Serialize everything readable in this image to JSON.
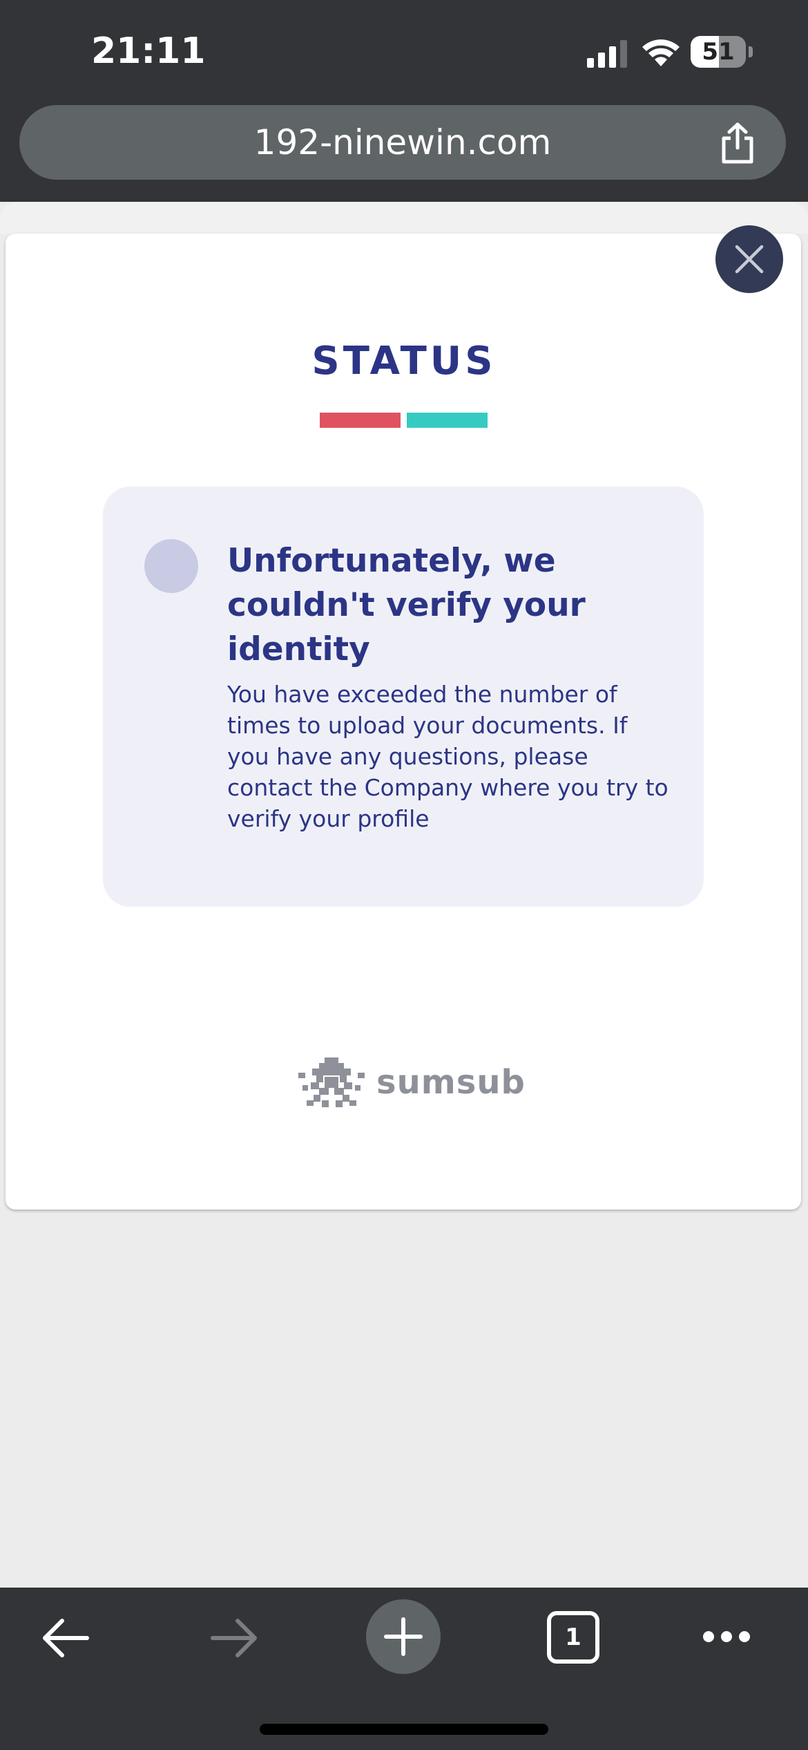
{
  "status_bar": {
    "time": "21:11",
    "battery": "51",
    "battery_level": 0.51,
    "icons": [
      "signal-icon",
      "wifi-icon",
      "battery-icon"
    ]
  },
  "browser": {
    "url": "192-ninewin.com",
    "share_icon": "share-icon",
    "toolbar": {
      "back_icon": "arrow-left-icon",
      "forward_icon": "arrow-right-icon",
      "new_tab_icon": "plus-icon",
      "tab_count": "1",
      "more_icon": "more-dots-icon"
    }
  },
  "modal": {
    "close_icon": "close-icon",
    "title": "STATUS",
    "accent_colors": [
      "#e05260",
      "#36cbc2"
    ],
    "card": {
      "heading": "Unfortunately, we couldn't verify your identity",
      "message": "You have exceeded the number of times to upload your documents. If you have any questions, please contact the Company where you try to verify your profile"
    },
    "brand": {
      "name": "sumsub",
      "logo_icon": "sumsub-logo-icon"
    }
  },
  "colors": {
    "primary": "#2c3585",
    "chrome": "#323437",
    "card_bg": "#eff0f7"
  }
}
